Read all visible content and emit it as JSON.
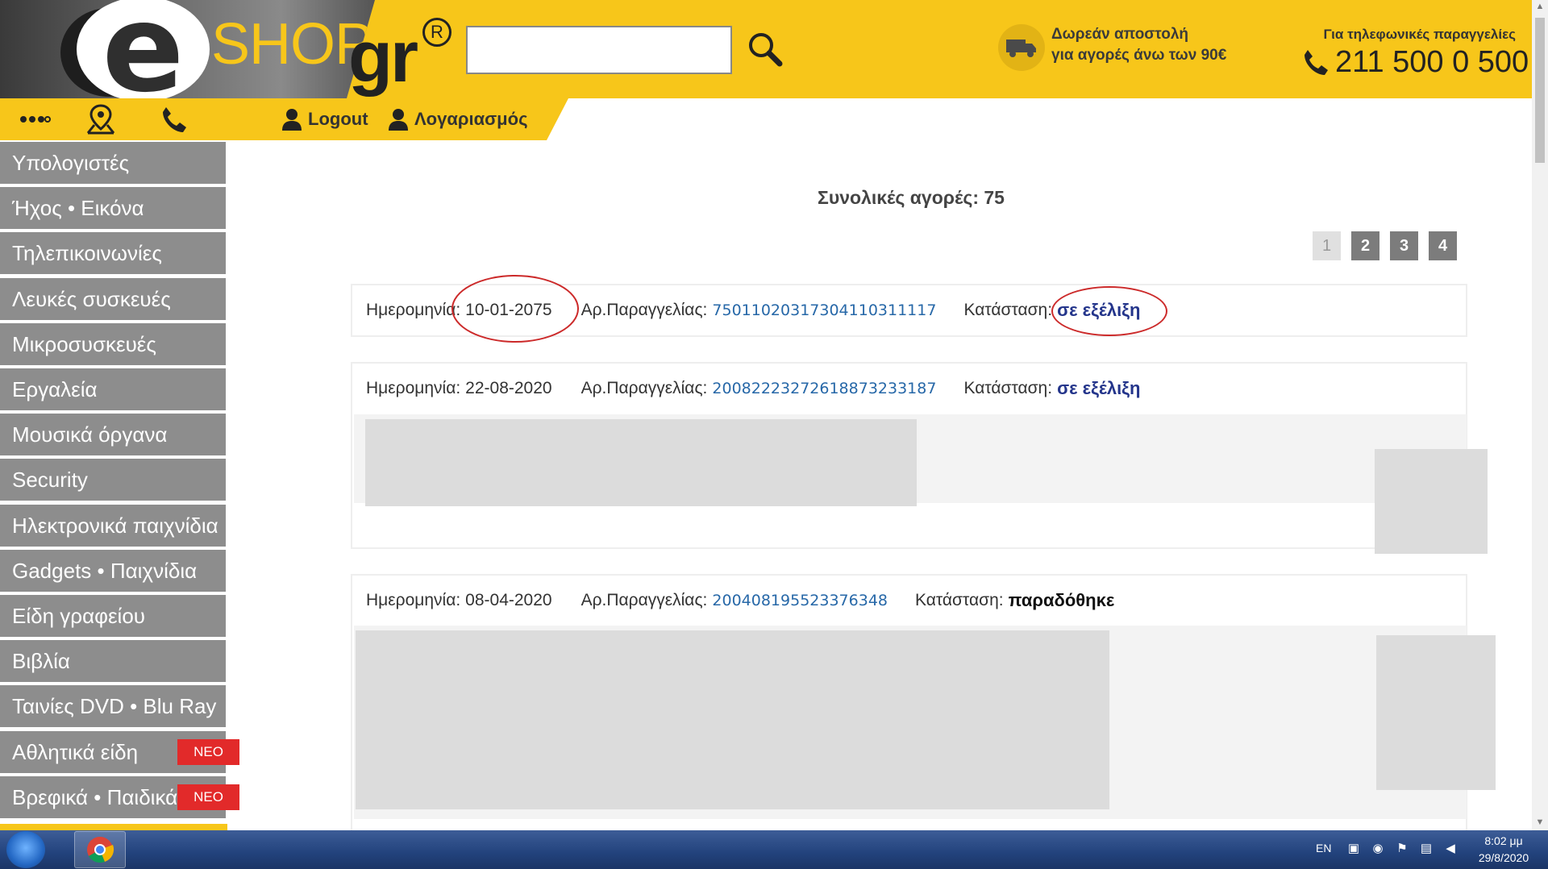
{
  "header": {
    "logo": {
      "e": "e",
      "shop": "SHOP",
      "gr": "gr",
      "registered": "R"
    },
    "search": {
      "value": "",
      "placeholder": ""
    },
    "shipping": {
      "line1": "Δωρεάν αποστολή",
      "line2": "για αγορές άνω των 90€"
    },
    "phone": {
      "caption": "Για τηλεφωνικές παραγγελίες",
      "number": "211 500 0 500"
    }
  },
  "toolbar": {
    "logout": "Logout",
    "account": "Λογαριασμός"
  },
  "sidebar": {
    "categories": [
      {
        "label": "Υπολογιστές"
      },
      {
        "label": "Ήχος • Εικόνα"
      },
      {
        "label": "Τηλεπικοινωνίες"
      },
      {
        "label": "Λευκές συσκευές"
      },
      {
        "label": "Μικροσυσκευές"
      },
      {
        "label": "Εργαλεία"
      },
      {
        "label": "Μουσικά όργανα"
      },
      {
        "label": "Security"
      },
      {
        "label": "Ηλεκτρονικά παιχνίδια"
      },
      {
        "label": "Gadgets • Παιχνίδια"
      },
      {
        "label": "Είδη γραφείου"
      },
      {
        "label": "Βιβλία"
      },
      {
        "label": "Ταινίες DVD • Blu Ray"
      },
      {
        "label": "Αθλητικά είδη",
        "badge": "ΝΕΟ"
      },
      {
        "label": "Βρεφικά • Παιδικά",
        "badge": "ΝΕΟ"
      }
    ]
  },
  "main": {
    "total_purchases": "Συνολικές αγορές: 75",
    "pagination": {
      "pages": [
        "1",
        "2",
        "3",
        "4"
      ],
      "current": "1"
    },
    "orders": [
      {
        "date_label": "Ημερομηνία:",
        "date": "10-01-2075",
        "id_label": "Αρ.Παραγγελίας:",
        "id": "75011020317304110311117",
        "status_label": "Κατάσταση:",
        "status": "σε εξέλιξη"
      },
      {
        "date_label": "Ημερομηνία:",
        "date": "22-08-2020",
        "id_label": "Αρ.Παραγγελίας:",
        "id": "20082223272618873233187",
        "status_label": "Κατάσταση:",
        "status": "σε εξέλιξη"
      },
      {
        "date_label": "Ημερομηνία:",
        "date": "08-04-2020",
        "id_label": "Αρ.Παραγγελίας:",
        "id": "200408195523376348",
        "status_label": "Κατάσταση:",
        "status": "παραδόθηκε"
      }
    ]
  },
  "taskbar": {
    "language": "EN",
    "time": "8:02 μμ",
    "date": "29/8/2020"
  },
  "colors": {
    "brand_yellow": "#f7c61a",
    "sidebar_gray": "#8d8d8d",
    "badge_red": "#e22a2a",
    "link_blue": "#2768a8",
    "status_blue": "#24358b",
    "annotation_red": "#cc2a2a"
  }
}
